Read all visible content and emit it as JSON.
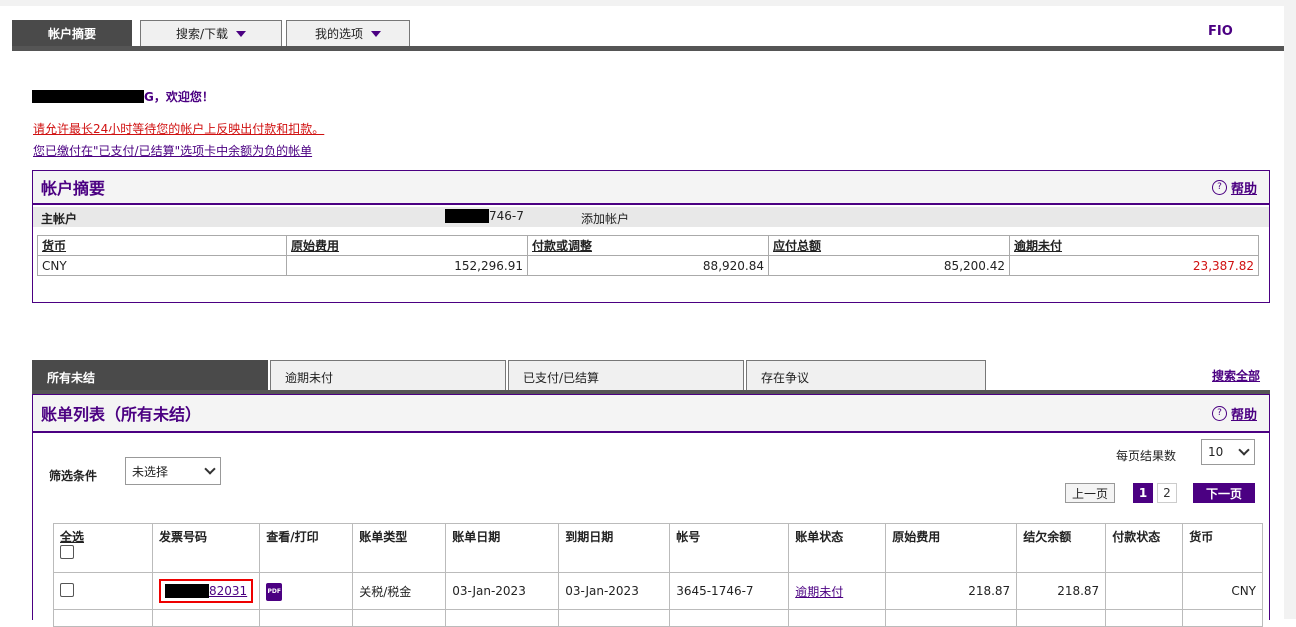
{
  "nav": {
    "tabs": [
      {
        "label": "帐户摘要"
      },
      {
        "label": "搜索/下载"
      },
      {
        "label": "我的选项"
      }
    ],
    "brand": "FIO"
  },
  "welcome": {
    "suffix": "G，欢迎您！"
  },
  "notices": [
    "请允许最长24小时等待您的帐户上反映出付款和扣款。",
    "您已缴付在\"已支付/已结算\"选项卡中余额为负的帐单"
  ],
  "summary": {
    "title": "帐户摘要",
    "help": "帮助",
    "main_account_label": "主帐户",
    "main_account_number": "746-7",
    "add_account": "添加帐户",
    "columns": [
      "货币",
      "原始费用",
      "付款或调整",
      "应付总额",
      "逾期未付"
    ],
    "rows": [
      [
        "CNY",
        "152,296.91",
        "88,920.84",
        "85,200.42",
        "23,387.82"
      ]
    ]
  },
  "bill_tabs": [
    "所有未结",
    "逾期未付",
    "已支付/已结算",
    "存在争议"
  ],
  "search_all": "搜索全部",
  "bills": {
    "title": "账单列表（所有未结）",
    "help": "帮助",
    "filter_label": "筛选条件",
    "filter_value": "未选择",
    "per_page_label": "每页结果数",
    "per_page_value": "10",
    "pager": {
      "prev": "上一页",
      "current": "1",
      "page2": "2",
      "next": "下一页"
    },
    "columns": [
      "全选",
      "发票号码",
      "查看/打印",
      "账单类型",
      "账单日期",
      "到期日期",
      "帐号",
      "账单状态",
      "原始费用",
      "结欠余额",
      "付款状态",
      "货币"
    ],
    "rows": [
      {
        "invoice_suffix": "82031",
        "pdf_label": "PDF",
        "type": "关税/税金",
        "bill_date": "03-Jan-2023",
        "due_date": "03-Jan-2023",
        "account": "3645-1746-7",
        "status": "逾期未付",
        "original": "218.87",
        "balance": "218.87",
        "payment_status": "",
        "currency": "CNY"
      }
    ]
  }
}
